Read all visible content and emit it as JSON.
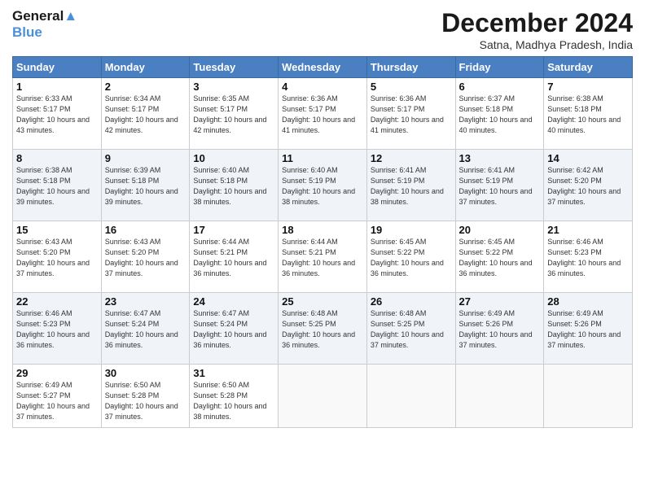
{
  "header": {
    "logo_line1": "General",
    "logo_line2": "Blue",
    "title": "December 2024",
    "location": "Satna, Madhya Pradesh, India"
  },
  "weekdays": [
    "Sunday",
    "Monday",
    "Tuesday",
    "Wednesday",
    "Thursday",
    "Friday",
    "Saturday"
  ],
  "weeks": [
    [
      {
        "day": "1",
        "sunrise": "6:33 AM",
        "sunset": "5:17 PM",
        "daylight": "10 hours and 43 minutes."
      },
      {
        "day": "2",
        "sunrise": "6:34 AM",
        "sunset": "5:17 PM",
        "daylight": "10 hours and 42 minutes."
      },
      {
        "day": "3",
        "sunrise": "6:35 AM",
        "sunset": "5:17 PM",
        "daylight": "10 hours and 42 minutes."
      },
      {
        "day": "4",
        "sunrise": "6:36 AM",
        "sunset": "5:17 PM",
        "daylight": "10 hours and 41 minutes."
      },
      {
        "day": "5",
        "sunrise": "6:36 AM",
        "sunset": "5:17 PM",
        "daylight": "10 hours and 41 minutes."
      },
      {
        "day": "6",
        "sunrise": "6:37 AM",
        "sunset": "5:18 PM",
        "daylight": "10 hours and 40 minutes."
      },
      {
        "day": "7",
        "sunrise": "6:38 AM",
        "sunset": "5:18 PM",
        "daylight": "10 hours and 40 minutes."
      }
    ],
    [
      {
        "day": "8",
        "sunrise": "6:38 AM",
        "sunset": "5:18 PM",
        "daylight": "10 hours and 39 minutes."
      },
      {
        "day": "9",
        "sunrise": "6:39 AM",
        "sunset": "5:18 PM",
        "daylight": "10 hours and 39 minutes."
      },
      {
        "day": "10",
        "sunrise": "6:40 AM",
        "sunset": "5:18 PM",
        "daylight": "10 hours and 38 minutes."
      },
      {
        "day": "11",
        "sunrise": "6:40 AM",
        "sunset": "5:19 PM",
        "daylight": "10 hours and 38 minutes."
      },
      {
        "day": "12",
        "sunrise": "6:41 AM",
        "sunset": "5:19 PM",
        "daylight": "10 hours and 38 minutes."
      },
      {
        "day": "13",
        "sunrise": "6:41 AM",
        "sunset": "5:19 PM",
        "daylight": "10 hours and 37 minutes."
      },
      {
        "day": "14",
        "sunrise": "6:42 AM",
        "sunset": "5:20 PM",
        "daylight": "10 hours and 37 minutes."
      }
    ],
    [
      {
        "day": "15",
        "sunrise": "6:43 AM",
        "sunset": "5:20 PM",
        "daylight": "10 hours and 37 minutes."
      },
      {
        "day": "16",
        "sunrise": "6:43 AM",
        "sunset": "5:20 PM",
        "daylight": "10 hours and 37 minutes."
      },
      {
        "day": "17",
        "sunrise": "6:44 AM",
        "sunset": "5:21 PM",
        "daylight": "10 hours and 36 minutes."
      },
      {
        "day": "18",
        "sunrise": "6:44 AM",
        "sunset": "5:21 PM",
        "daylight": "10 hours and 36 minutes."
      },
      {
        "day": "19",
        "sunrise": "6:45 AM",
        "sunset": "5:22 PM",
        "daylight": "10 hours and 36 minutes."
      },
      {
        "day": "20",
        "sunrise": "6:45 AM",
        "sunset": "5:22 PM",
        "daylight": "10 hours and 36 minutes."
      },
      {
        "day": "21",
        "sunrise": "6:46 AM",
        "sunset": "5:23 PM",
        "daylight": "10 hours and 36 minutes."
      }
    ],
    [
      {
        "day": "22",
        "sunrise": "6:46 AM",
        "sunset": "5:23 PM",
        "daylight": "10 hours and 36 minutes."
      },
      {
        "day": "23",
        "sunrise": "6:47 AM",
        "sunset": "5:24 PM",
        "daylight": "10 hours and 36 minutes."
      },
      {
        "day": "24",
        "sunrise": "6:47 AM",
        "sunset": "5:24 PM",
        "daylight": "10 hours and 36 minutes."
      },
      {
        "day": "25",
        "sunrise": "6:48 AM",
        "sunset": "5:25 PM",
        "daylight": "10 hours and 36 minutes."
      },
      {
        "day": "26",
        "sunrise": "6:48 AM",
        "sunset": "5:25 PM",
        "daylight": "10 hours and 37 minutes."
      },
      {
        "day": "27",
        "sunrise": "6:49 AM",
        "sunset": "5:26 PM",
        "daylight": "10 hours and 37 minutes."
      },
      {
        "day": "28",
        "sunrise": "6:49 AM",
        "sunset": "5:26 PM",
        "daylight": "10 hours and 37 minutes."
      }
    ],
    [
      {
        "day": "29",
        "sunrise": "6:49 AM",
        "sunset": "5:27 PM",
        "daylight": "10 hours and 37 minutes."
      },
      {
        "day": "30",
        "sunrise": "6:50 AM",
        "sunset": "5:28 PM",
        "daylight": "10 hours and 37 minutes."
      },
      {
        "day": "31",
        "sunrise": "6:50 AM",
        "sunset": "5:28 PM",
        "daylight": "10 hours and 38 minutes."
      },
      null,
      null,
      null,
      null
    ]
  ]
}
